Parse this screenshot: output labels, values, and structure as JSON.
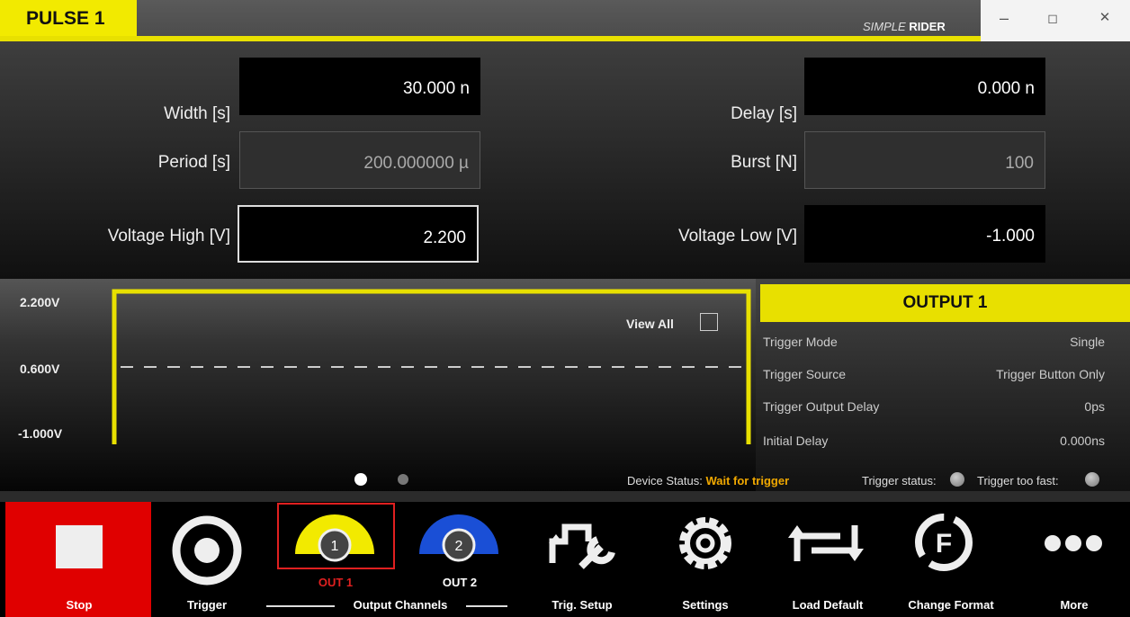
{
  "window": {
    "title": "PULSE 1",
    "brand_prefix": "SIMPLE",
    "brand_name": "RIDER",
    "controls": {
      "minimize": "–",
      "restore": "◻",
      "close": "✕"
    }
  },
  "params": {
    "width": {
      "label": "Width [s]",
      "value": "30.000 n"
    },
    "delay": {
      "label": "Delay [s]",
      "value": "0.000 n"
    },
    "period": {
      "label": "Period [s]",
      "value": "200.000000 µ"
    },
    "burst": {
      "label": "Burst [N]",
      "value": "100"
    },
    "vhigh": {
      "label": "Voltage High [V]",
      "value": "2.200"
    },
    "vlow": {
      "label": "Voltage Low [V]",
      "value": "-1.000"
    }
  },
  "graph": {
    "y_high": "2.200V",
    "y_mid": "0.600V",
    "y_low": "-1.000V",
    "view_all_label": "View All",
    "view_all_checked": false
  },
  "output": {
    "header": "OUTPUT 1",
    "rows": [
      {
        "label": "Trigger Mode",
        "value": "Single"
      },
      {
        "label": "Trigger Source",
        "value": "Trigger Button Only"
      },
      {
        "label": "Trigger Output Delay",
        "value": "0ps"
      },
      {
        "label": "Initial Delay",
        "value": "0.000ns"
      }
    ]
  },
  "status": {
    "device_label": "Device Status:",
    "device_value": "Wait for trigger",
    "trigger_status_label": "Trigger status:",
    "trigger_fast_label": "Trigger too fast:"
  },
  "toolbar": {
    "stop": "Stop",
    "trigger": "Trigger",
    "out1_num": "1",
    "out1_label": "OUT 1",
    "out2_num": "2",
    "out2_label": "OUT 2",
    "channels_group": "Output Channels",
    "trig_setup": "Trig. Setup",
    "settings": "Settings",
    "load_default": "Load Default",
    "change_format": "Change Format",
    "more": "More"
  },
  "colors": {
    "accent_yellow": "#e8e000",
    "stop_red": "#e00000",
    "out2_blue": "#1a4fd6",
    "status_orange": "#f0a800"
  }
}
